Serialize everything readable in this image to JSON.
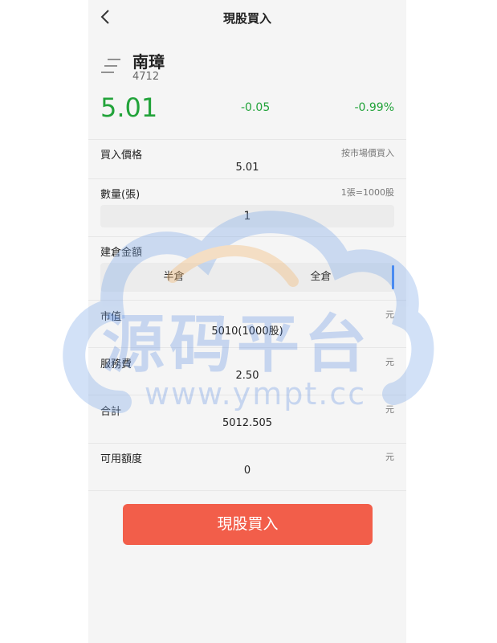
{
  "header": {
    "title": "現股買入",
    "back_icon": "chevron-left-icon"
  },
  "stock": {
    "name": "南璋",
    "code": "4712",
    "price": "5.01",
    "change": "-0.05",
    "change_pct": "-0.99%",
    "price_color": "#22a33a"
  },
  "buy_price": {
    "label": "買入價格",
    "hint": "按市場價買入",
    "value": "5.01"
  },
  "quantity": {
    "label": "數量(張)",
    "hint": "1張=1000股",
    "value": "1"
  },
  "position": {
    "label": "建倉金額",
    "options": [
      "半倉",
      "全倉"
    ]
  },
  "market_value": {
    "label": "市值",
    "unit": "元",
    "value": "5010(1000股)"
  },
  "service_fee": {
    "label": "服務費",
    "unit": "元",
    "value": "2.50"
  },
  "total": {
    "label": "合計",
    "unit": "元",
    "value": "5012.505"
  },
  "available": {
    "label": "可用額度",
    "unit": "元",
    "value": "0"
  },
  "submit": {
    "label": "現股買入",
    "color": "#f25e4a"
  },
  "watermark": {
    "text": "源码平台",
    "url": "www.ympt.cc"
  }
}
